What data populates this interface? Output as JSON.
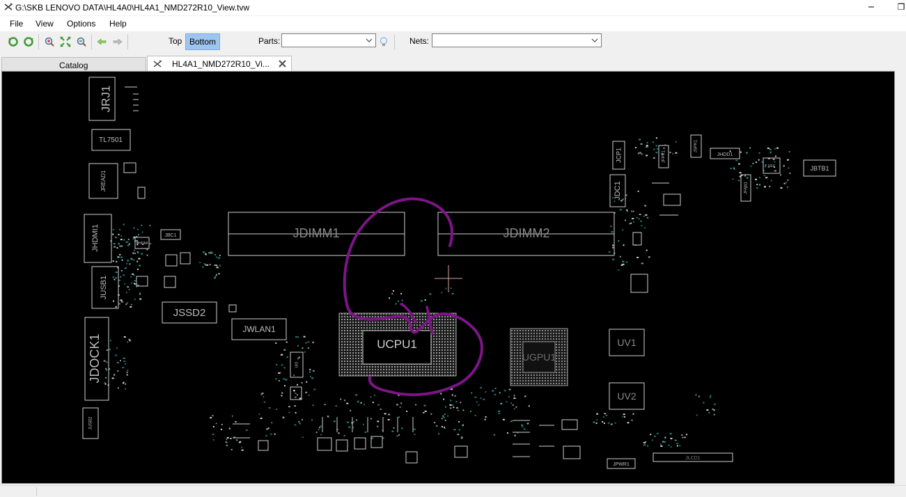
{
  "window": {
    "title": "G:\\SKB LENOVO DATA\\HL4A0\\HL4A1_NMD272R10_View.tvw",
    "restore_glyph": "❐"
  },
  "menu": {
    "items": [
      "File",
      "View",
      "Options",
      "Help"
    ]
  },
  "toolbar": {
    "layer_top": "Top",
    "layer_bottom": "Bottom",
    "parts_label": "Parts:",
    "parts_value": "",
    "nets_label": "Nets:",
    "nets_value": ""
  },
  "tabs": [
    {
      "label": "Catalog",
      "active": false
    },
    {
      "label": "HL4A1_NMD272R10_Vi...",
      "active": true
    }
  ],
  "board": {
    "silk_color": "#cfcfcf",
    "annotation_color": "#7d1487",
    "labels": {
      "jrj1": "JRJ1",
      "tl7501": "TL7501",
      "jread1": "JREAD1",
      "jhdmi1": "JHDMI1",
      "jbc1": "JBC1",
      "jusb1": "JUSB1",
      "jssd2": "JSSD2",
      "jdock1": "JDOCK1",
      "jusb2": "JUSB2",
      "jwlan1": "JWLAN1",
      "jdimm1": "JDIMM1",
      "jdimm2": "JDIMM2",
      "ucpu1": "UCPU1",
      "ugpu1": "UGPU1",
      "uv1": "UV1",
      "uv2": "UV2",
      "jcp1": "JCP1",
      "jdc1": "JDC1",
      "jfpr1": "JFPR1",
      "jspk1": "JSPK1",
      "jhdd1": "JHDD1",
      "jfan1": "JFAN1",
      "jbtb1": "JBTB1",
      "jpwr1": "JPWR1",
      "jlcd1": "JLCD1",
      "uhdmi": "UHDMI",
      "uio": "UIO",
      "uec": "UEC"
    }
  }
}
